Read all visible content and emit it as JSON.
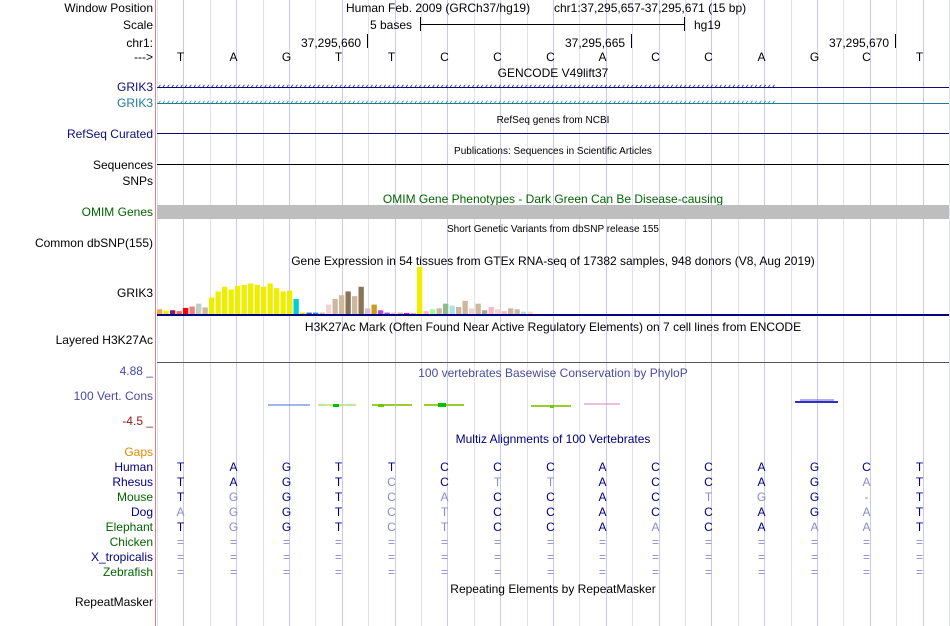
{
  "labels": {
    "window_position": "Window Position",
    "scale": "Scale",
    "chr": "chr1:",
    "arrow": "--->",
    "grik3_a": "GRIK3",
    "grik3_b": "GRIK3",
    "refseq": "RefSeq Curated",
    "sequences": "Sequences",
    "snps": "SNPs",
    "omim": "OMIM Genes",
    "dbsnp": "Common dbSNP(155)",
    "gtex": "GRIK3",
    "h3k27ac": "Layered H3K27Ac",
    "cons_hi": "4.88 _",
    "cons": "100 Vert. Cons",
    "cons_lo": "-4.5 _",
    "gaps": "Gaps",
    "repeatmasker": "RepeatMasker"
  },
  "header": {
    "assembly": "Human Feb. 2009 (GRCh37/hg19)",
    "position": "chr1:37,295,657-37,295,671 (15 bp)",
    "scale_text": "5 bases",
    "scale_db": "hg19",
    "coords": [
      "37,295,660",
      "37,295,665",
      "37,295,670"
    ]
  },
  "sequence": [
    "T",
    "A",
    "G",
    "T",
    "T",
    "C",
    "C",
    "C",
    "A",
    "C",
    "C",
    "A",
    "G",
    "C",
    "T"
  ],
  "tracks": {
    "gencode": "GENCODE V49lift37",
    "refseq": "RefSeq genes from NCBI",
    "publications": "Publications: Sequences in Scientific Articles",
    "omim": "OMIM Gene Phenotypes - Dark Green Can Be Disease-causing",
    "dbsnp": "Short Genetic Variants from dbSNP release 155",
    "gtex": "Gene Expression in 54 tissues from GTEx RNA-seq of 17382 samples, 948 donors (V8, Aug 2019)",
    "h3k27ac": "H3K27Ac Mark (Often Found Near Active Regulatory Elements) on 7 cell lines from ENCODE",
    "phylop": "100 vertebrates Basewise Conservation by PhyloP",
    "multiz": "Multiz Alignments of 100 Vertebrates",
    "repeatmasker": "Repeating Elements by RepeatMasker"
  },
  "gtex_expression": [
    0.1,
    0.07,
    0.08,
    0.06,
    0.13,
    0.16,
    0.22,
    0.14,
    0.35,
    0.48,
    0.58,
    0.52,
    0.6,
    0.62,
    0.65,
    0.62,
    0.58,
    0.65,
    0.55,
    0.48,
    0.5,
    0.32,
    0.03,
    0.03,
    0.03,
    0.03,
    0.2,
    0.32,
    0.4,
    0.48,
    0.38,
    0.58,
    0.12,
    0.2,
    0.08,
    0.03,
    0.03,
    0.03,
    0.02,
    0.02,
    1.0,
    0.06,
    0.1,
    0.12,
    0.22,
    0.18,
    0.15,
    0.28,
    0.12,
    0.22,
    0.08,
    0.15,
    0.1,
    0.06,
    0.12,
    0.1,
    0.05,
    0.05
  ],
  "gtex_colors": [
    "#FFA54F",
    "#EEEE00",
    "#8B1C62",
    "#EE6A50",
    "#FF0000",
    "#F08080",
    "#C1CDC1",
    "#CDB79E",
    "#EEEE00",
    "#EEEE00",
    "#EEEE00",
    "#EEEE00",
    "#EEEE00",
    "#EEEE00",
    "#EEEE00",
    "#EEEE00",
    "#EEEE00",
    "#EEEE00",
    "#EEEE00",
    "#EEEE00",
    "#EEEE00",
    "#00CED1",
    "#FFD700",
    "#3A5FCD",
    "#1E90FF",
    "#CDB79E",
    "#EED5D2",
    "#CDB79E",
    "#CDB79E",
    "#8B7355",
    "#CDB79E",
    "#8B7355",
    "#D8BFD8",
    "#CD9B1D",
    "#B452CD",
    "#7A67EE",
    "#FFB6C1",
    "#CDB79E",
    "#FF00FF",
    "#CDB79E",
    "#EEEE00",
    "#FFB6C1",
    "#9AFF9A",
    "#CDB79E",
    "#8FBC8F",
    "#B0E0E6",
    "#CDB79E",
    "#CDB79E",
    "#EED5D2",
    "#CDB79E",
    "#A6A6A6",
    "#FFB6C1",
    "#EED5D2",
    "#FFB6C1",
    "#CDB79E",
    "#CDB79E",
    "#B0E0E6",
    "#FFDAB9"
  ],
  "species": [
    {
      "name": "Human",
      "color": "#000080",
      "bases": [
        "T",
        "A",
        "G",
        "T",
        "T",
        "C",
        "C",
        "C",
        "A",
        "C",
        "C",
        "A",
        "G",
        "C",
        "T"
      ]
    },
    {
      "name": "Rhesus",
      "color": "#000080",
      "bases": [
        "T",
        "A",
        "G",
        "T",
        "C",
        "C",
        "T",
        "T",
        "A",
        "C",
        "C",
        "A",
        "G",
        "A",
        "T"
      ]
    },
    {
      "name": "Mouse",
      "color": "#006400",
      "bases": [
        "T",
        "G",
        "G",
        "T",
        "C",
        "A",
        "C",
        "C",
        "A",
        "C",
        "T",
        "G",
        "G",
        "-",
        "T"
      ]
    },
    {
      "name": "Dog",
      "color": "#000080",
      "bases": [
        "A",
        "G",
        "G",
        "T",
        "C",
        "T",
        "C",
        "C",
        "A",
        "C",
        "C",
        "A",
        "G",
        "A",
        "T"
      ]
    },
    {
      "name": "Elephant",
      "color": "#006400",
      "bases": [
        "T",
        "G",
        "G",
        "T",
        "C",
        "T",
        "C",
        "C",
        "A",
        "A",
        "C",
        "A",
        "A",
        "A",
        "T"
      ]
    },
    {
      "name": "Chicken",
      "color": "#006400",
      "bases": [
        "=",
        "=",
        "=",
        "=",
        "=",
        "=",
        "=",
        "=",
        "=",
        "=",
        "=",
        "=",
        "=",
        "=",
        "="
      ]
    },
    {
      "name": "X_tropicalis",
      "color": "#000080",
      "bases": [
        "=",
        "=",
        "=",
        "=",
        "=",
        "=",
        "=",
        "=",
        "=",
        "=",
        "=",
        "=",
        "=",
        "=",
        "="
      ]
    },
    {
      "name": "Zebrafish",
      "color": "#006400",
      "bases": [
        "=",
        "=",
        "=",
        "=",
        "=",
        "=",
        "=",
        "=",
        "=",
        "=",
        "=",
        "=",
        "=",
        "=",
        "="
      ]
    }
  ],
  "colors": {
    "gene_dark": "#0C0C78",
    "gene_teal": "#1C7C94",
    "omim_text": "#006400",
    "cons_label": "#4A4AA0",
    "cons_lo": "#8B1A1A",
    "gaps": "#E08A00",
    "mismatch": "#8C8CC8"
  }
}
